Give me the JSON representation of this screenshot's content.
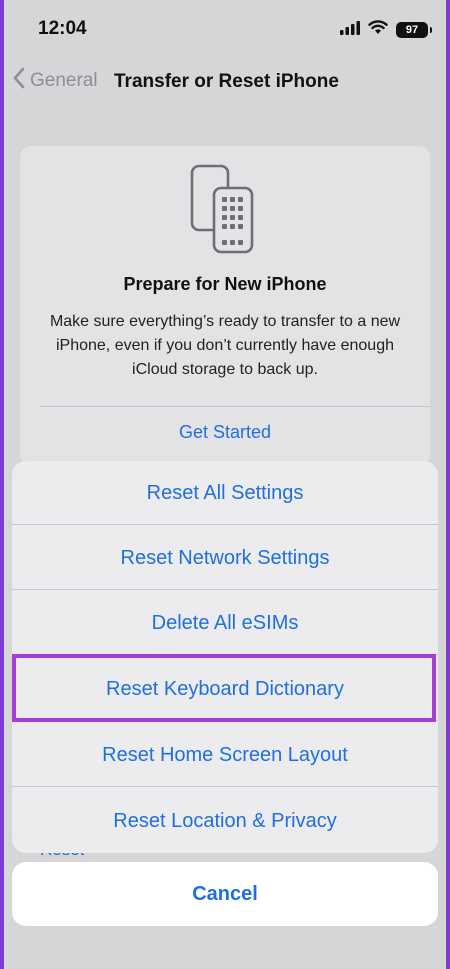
{
  "status_bar": {
    "time": "12:04",
    "battery": "97",
    "icons": [
      "cellular-signal-icon",
      "wifi-icon",
      "battery-icon"
    ]
  },
  "nav": {
    "back_label": "General",
    "title": "Transfer or Reset iPhone"
  },
  "card": {
    "icon": "phone-transfer-icon",
    "title": "Prepare for New iPhone",
    "description": "Make sure everything’s ready to transfer to a new iPhone, even if you don’t currently have enough iCloud storage to back up.",
    "action_label": "Get Started"
  },
  "background_peek": {
    "reset_label": "Reset"
  },
  "action_sheet": {
    "items": [
      {
        "label": "Reset All Settings"
      },
      {
        "label": "Reset Network Settings"
      },
      {
        "label": "Delete All eSIMs"
      },
      {
        "label": "Reset Keyboard Dictionary",
        "highlighted": true
      },
      {
        "label": "Reset Home Screen Layout"
      },
      {
        "label": "Reset Location & Privacy"
      }
    ],
    "cancel_label": "Cancel"
  },
  "colors": {
    "accent": "#1f6fe0",
    "highlight": "#a53ed8",
    "frame": "#7d3ad6",
    "dimmed_background": "#d6d6d8"
  }
}
